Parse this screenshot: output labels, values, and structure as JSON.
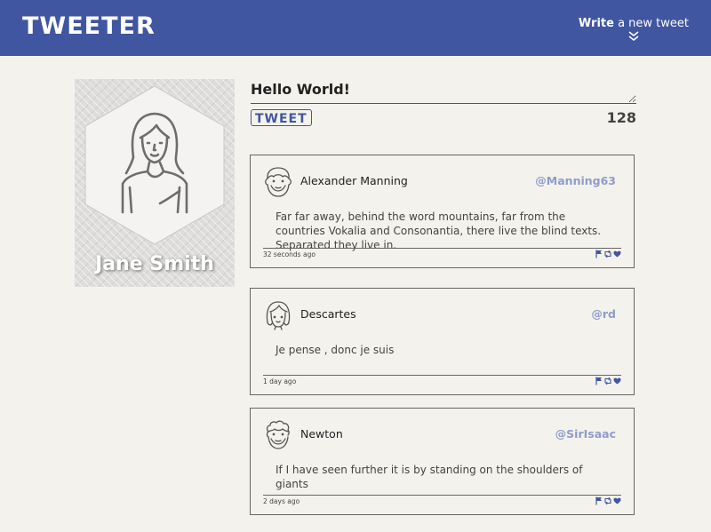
{
  "nav": {
    "brand": "TWEETER",
    "compose_strong": "Write",
    "compose_rest": " a new tweet",
    "chevron_icon": "double-chevron-down-icon"
  },
  "profile": {
    "name": "Jane Smith",
    "avatar_icon": "woman-avatar-icon"
  },
  "compose": {
    "text": "Hello World!",
    "button_label": "TWEET",
    "counter": "128"
  },
  "tweets": [
    {
      "name": "Alexander Manning",
      "handle": "@Manning63",
      "text": "Far far away, behind the word mountains, far from the countries Vokalia and Consonantia, there live the blind texts. Separated they live in.",
      "time": "32 seconds ago",
      "avatar_icon": "bearded-man-avatar-icon"
    },
    {
      "name": "Descartes",
      "handle": "@rd",
      "text": "Je pense , donc je suis",
      "time": "1 day ago",
      "avatar_icon": "bob-hair-avatar-icon"
    },
    {
      "name": "Newton",
      "handle": "@SirIsaac",
      "text": "If I have seen further it is by standing on the shoulders of giants",
      "time": "2 days ago",
      "avatar_icon": "curly-hair-man-avatar-icon"
    }
  ],
  "actions": [
    "flag-icon",
    "retweet-icon",
    "heart-icon"
  ],
  "colors": {
    "accent": "#4056a1",
    "handle": "#8f9ccb",
    "background": "#f4f2ec"
  }
}
